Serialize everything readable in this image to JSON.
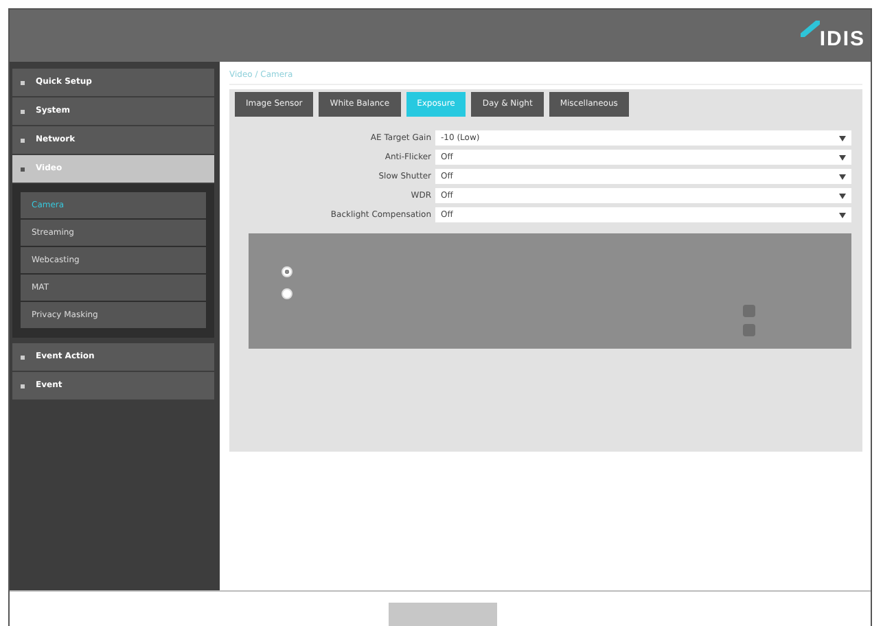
{
  "header": {
    "logo": "IDIS"
  },
  "sidebar": {
    "items": [
      {
        "label": "Quick Setup",
        "selected": false
      },
      {
        "label": "System",
        "selected": false
      },
      {
        "label": "Network",
        "selected": false
      },
      {
        "label": "Video",
        "selected": true,
        "children": [
          {
            "label": "Camera",
            "selected": true
          },
          {
            "label": "Streaming",
            "selected": false
          },
          {
            "label": "Webcasting",
            "selected": false
          },
          {
            "label": "MAT",
            "selected": false
          },
          {
            "label": "Privacy Masking",
            "selected": false
          }
        ]
      },
      {
        "label": "Event Action",
        "selected": false
      },
      {
        "label": "Event",
        "selected": false
      }
    ]
  },
  "breadcrumb": "Video / Camera",
  "tabs": [
    {
      "label": "Image Sensor",
      "selected": false
    },
    {
      "label": "White Balance",
      "selected": false
    },
    {
      "label": "Exposure",
      "selected": true
    },
    {
      "label": "Day & Night",
      "selected": false
    },
    {
      "label": "Miscellaneous",
      "selected": false
    }
  ],
  "fields": [
    {
      "label": "AE Target Gain",
      "value": "-10 (Low)"
    },
    {
      "label": "Anti-Flicker",
      "value": "Off"
    },
    {
      "label": "Slow Shutter",
      "value": "Off"
    },
    {
      "label": "WDR",
      "value": "Off"
    },
    {
      "label": "Backlight Compensation",
      "value": "Off"
    }
  ],
  "disabled_section": {
    "radios": [
      {
        "selected": true
      },
      {
        "selected": false
      }
    ],
    "checkboxes": [
      {
        "checked": false
      },
      {
        "checked": false
      }
    ]
  }
}
